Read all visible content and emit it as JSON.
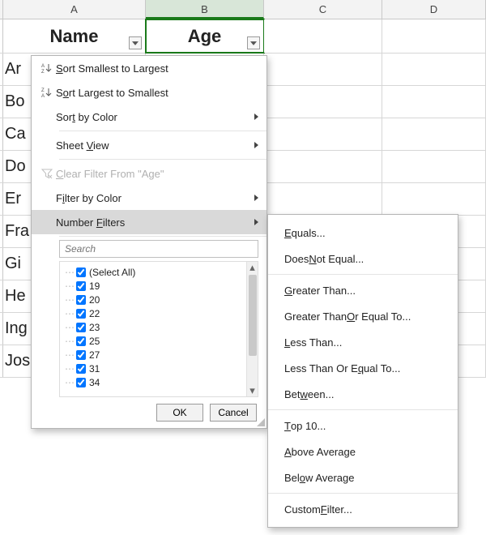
{
  "columns": {
    "A": "A",
    "B": "B",
    "C": "C",
    "D": "D"
  },
  "headers": {
    "name": "Name",
    "age": "Age"
  },
  "rows": [
    "Ar",
    "Bo",
    "Ca",
    "Do",
    "Er",
    "Fra",
    "Gi",
    "He",
    "Ing",
    "Jos"
  ],
  "menu": {
    "sort_asc": "Sort Smallest to Largest",
    "sort_desc": "Sort Largest to Smallest",
    "sort_color": "Sort by Color",
    "sheet_view": "Sheet View",
    "clear_filter": "Clear Filter From \"Age\"",
    "filter_color": "Filter by Color",
    "number_filters": "Number Filters",
    "search_placeholder": "Search",
    "select_all": "(Select All)",
    "values": [
      "19",
      "20",
      "22",
      "23",
      "25",
      "27",
      "31",
      "34"
    ],
    "ok": "OK",
    "cancel": "Cancel"
  },
  "number_filter_items": {
    "equals": "Equals...",
    "not_equal": "Does Not Equal...",
    "gt": "Greater Than...",
    "gte": "Greater Than Or Equal To...",
    "lt": "Less Than...",
    "lte": "Less Than Or Equal To...",
    "between": "Between...",
    "top10": "Top 10...",
    "above_avg": "Above Average",
    "below_avg": "Below Average",
    "custom": "Custom Filter..."
  }
}
